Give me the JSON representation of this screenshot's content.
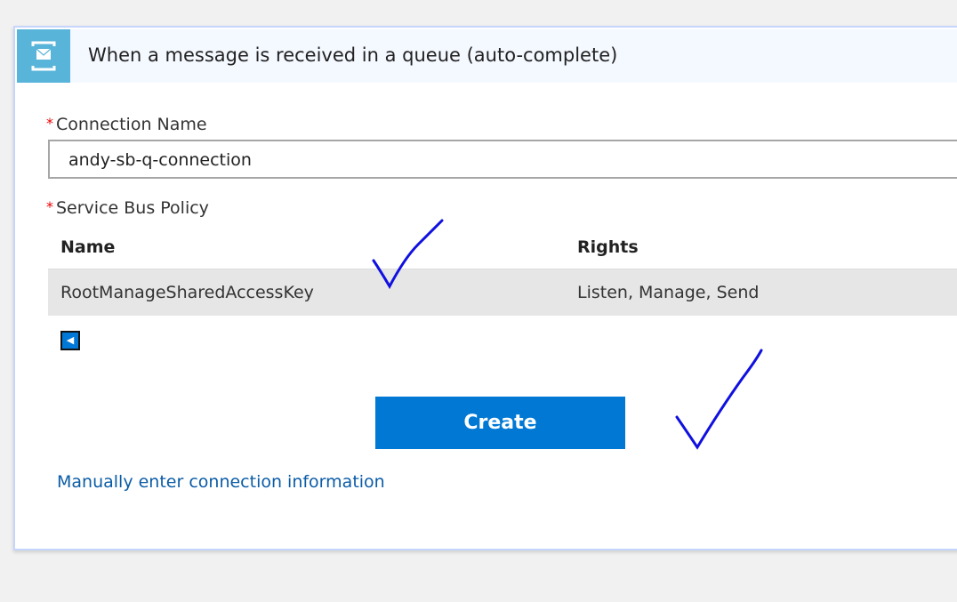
{
  "trigger": {
    "title": "When a message is received in a queue (auto-complete)",
    "icon": "service-bus-queue-icon",
    "icon_color": "#59b4d9"
  },
  "form": {
    "connection_name_label": "Connection Name",
    "connection_name_value": "andy-sb-q-connection",
    "required_mark": "*",
    "policy_label": "Service Bus Policy",
    "table": {
      "headers": [
        "Name",
        "Rights"
      ],
      "rows": [
        {
          "name": "RootManageSharedAccessKey",
          "rights": "Listen, Manage, Send"
        }
      ]
    },
    "pager_icon": "triangle-left-icon",
    "create_label": "Create",
    "manual_link": "Manually enter connection information"
  },
  "colors": {
    "accent": "#0078d4",
    "annotation_ink": "#1010e0"
  }
}
